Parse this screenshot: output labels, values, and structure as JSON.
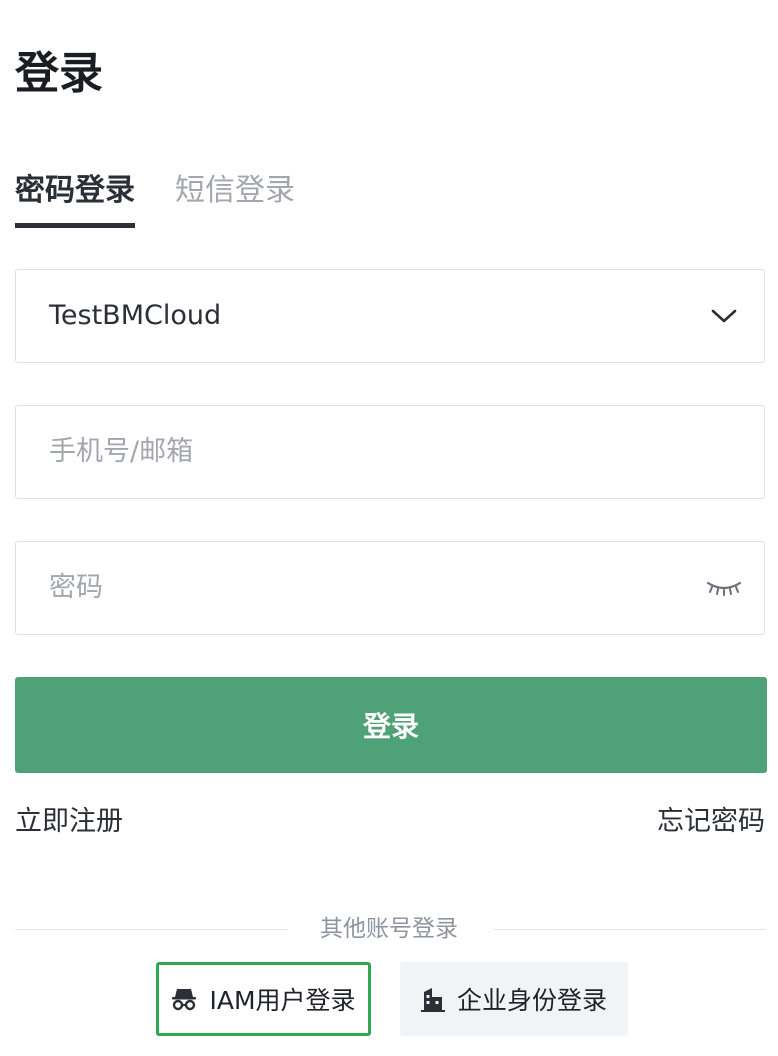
{
  "page": {
    "title": "登录"
  },
  "tabs": [
    {
      "label": "密码登录",
      "active": true
    },
    {
      "label": "短信登录",
      "active": false
    }
  ],
  "account_select": {
    "value": "TestBMCloud",
    "icon": "chevron-down-icon"
  },
  "username": {
    "placeholder": "手机号/邮箱",
    "value": ""
  },
  "password": {
    "placeholder": "密码",
    "value": "",
    "icon": "eye-closed-icon"
  },
  "login_button": {
    "label": "登录",
    "color": "#4fa277"
  },
  "links": {
    "register": "立即注册",
    "forgot": "忘记密码"
  },
  "other_login": {
    "divider_label": "其他账号登录",
    "options": [
      {
        "label": "IAM用户登录",
        "icon": "incognito-user-icon",
        "selected": true,
        "highlight_color": "#2fa84f"
      },
      {
        "label": "企业身份登录",
        "icon": "enterprise-building-icon",
        "selected": false
      }
    ]
  }
}
